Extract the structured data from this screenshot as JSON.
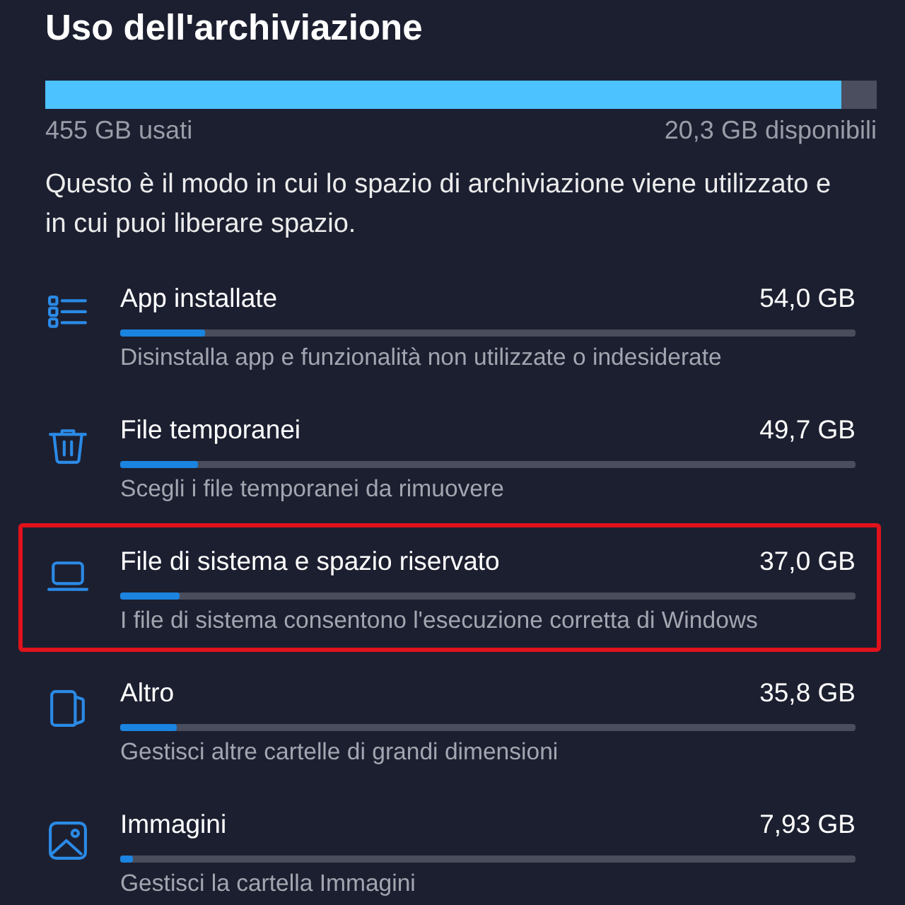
{
  "header": {
    "title": "Uso dell'archiviazione"
  },
  "storage": {
    "level": 0.957,
    "used": "455 GB usati",
    "available": "20,3 GB disponibili"
  },
  "description": "Questo è il modo in cui lo spazio di archiviazione viene utilizzato e in cui puoi liberare spazio.",
  "categories": [
    {
      "kind": "apps",
      "name": "App installate",
      "size": "54,0 GB",
      "level": 0.115,
      "hint": "Disinstalla app e funzionalità non utilizzate o indesiderate",
      "highlighted": false
    },
    {
      "kind": "temp",
      "name": "File temporanei",
      "size": "49,7 GB",
      "level": 0.106,
      "hint": "Scegli i file temporanei da rimuovere",
      "highlighted": false
    },
    {
      "kind": "system",
      "name": "File di sistema e spazio riservato",
      "size": "37,0 GB",
      "level": 0.081,
      "hint": "I file di sistema consentono l'esecuzione corretta di Windows",
      "highlighted": true
    },
    {
      "kind": "other",
      "name": "Altro",
      "size": "35,8 GB",
      "level": 0.077,
      "hint": "Gestisci altre cartelle di grandi dimensioni",
      "highlighted": false
    },
    {
      "kind": "pictures",
      "name": "Immagini",
      "size": "7,93 GB",
      "level": 0.017,
      "hint": "Gestisci la cartella Immagini",
      "highlighted": false
    }
  ]
}
